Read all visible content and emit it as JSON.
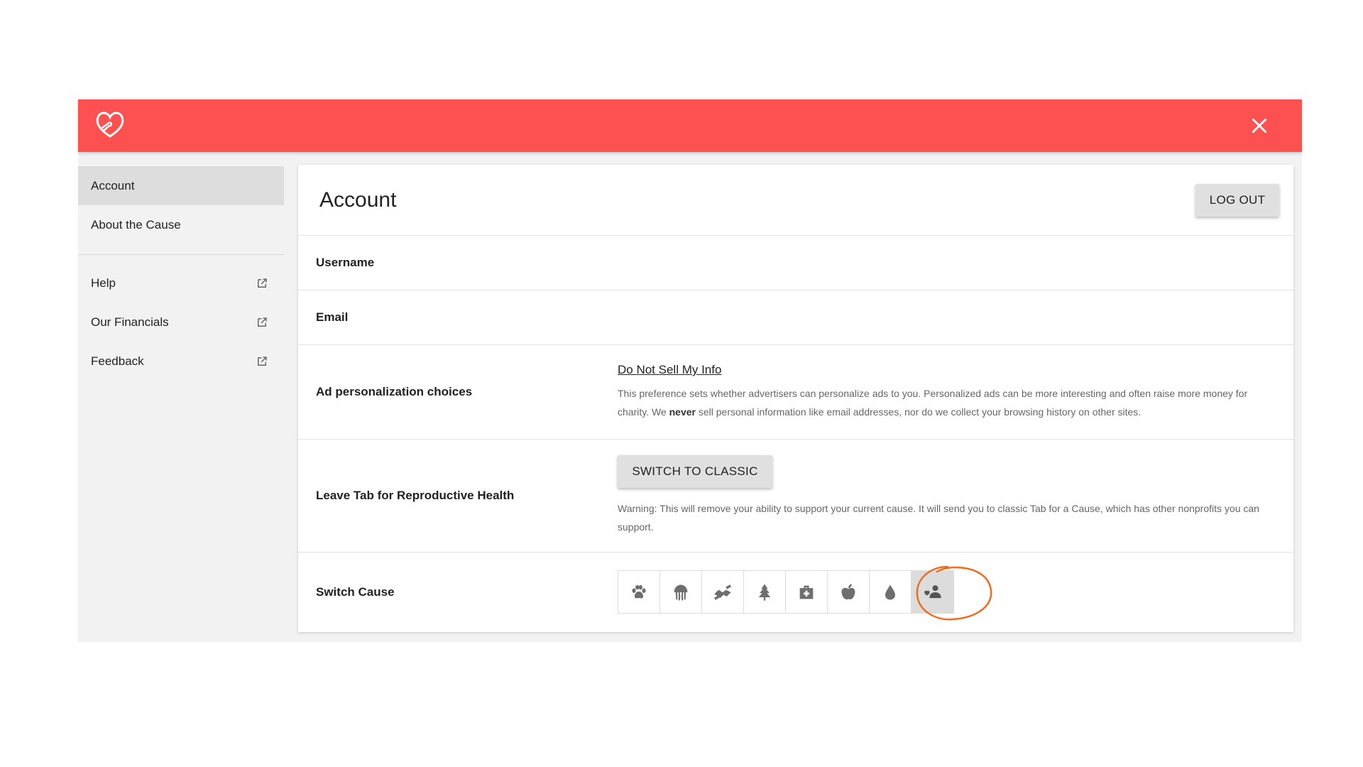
{
  "colors": {
    "brand": "#fc5150",
    "annotation": "#f26a1b"
  },
  "header": {
    "logo_icon": "heart-hands-logo",
    "close_icon": "close-icon"
  },
  "sidebar": {
    "items": [
      {
        "label": "Account",
        "active": true
      },
      {
        "label": "About the Cause"
      }
    ],
    "external_items": [
      {
        "label": "Help",
        "icon": "external-link-icon"
      },
      {
        "label": "Our Financials",
        "icon": "external-link-icon"
      },
      {
        "label": "Feedback",
        "icon": "external-link-icon"
      }
    ]
  },
  "main": {
    "title": "Account",
    "logout_label": "LOG OUT",
    "username_label": "Username",
    "email_label": "Email",
    "ads": {
      "label": "Ad personalization choices",
      "link": "Do Not Sell My Info",
      "desc_before": "This preference sets whether advertisers can personalize ads to you. Personalized ads can be more interesting and often raise more money for charity. We ",
      "desc_bold": "never",
      "desc_after": " sell personal information like email addresses, nor do we collect your browsing history on other sites."
    },
    "leave": {
      "label": "Leave Tab for Reproductive Health",
      "button": "SWITCH TO CLASSIC",
      "warning": "Warning: This will remove your ability to support your current cause. It will send you to classic Tab for a Cause, which has other nonprofits you can support."
    },
    "switch_cause": {
      "label": "Switch Cause",
      "causes": [
        "paw-icon",
        "jellyfish-icon",
        "handshake-icon",
        "tree-icon",
        "medical-kit-icon",
        "apple-icon",
        "water-drop-icon",
        "people-heart-icon"
      ],
      "selected_index": 7
    }
  }
}
